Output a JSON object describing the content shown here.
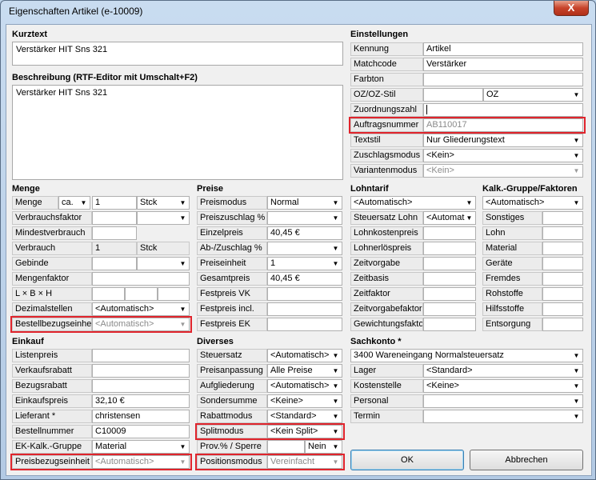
{
  "window": {
    "title": "Eigenschaften Artikel  (e-10009)",
    "close": "X"
  },
  "kurztext": {
    "heading": "Kurztext",
    "value": "Verstärker HIT Sns 321"
  },
  "beschreibung": {
    "heading": "Beschreibung (RTF-Editor mit Umschalt+F2)",
    "value": "Verstärker HIT Sns 321"
  },
  "einstellungen": {
    "heading": "Einstellungen",
    "kennung": {
      "label": "Kennung",
      "value": "Artikel"
    },
    "matchcode": {
      "label": "Matchcode",
      "value": "Verstärker"
    },
    "farbton": {
      "label": "Farbton",
      "value": ""
    },
    "ozstil": {
      "label": "OZ/OZ-Stil",
      "value1": "",
      "value2": "OZ"
    },
    "zuordnungszahl": {
      "label": "Zuordnungszahl",
      "value": ""
    },
    "auftragsnummer": {
      "label": "Auftragsnummer",
      "value": "AB110017"
    },
    "textstil": {
      "label": "Textstil",
      "value": "Nur Gliederungstext"
    },
    "zuschlagsmodus": {
      "label": "Zuschlagsmodus",
      "value": "<Kein>"
    },
    "variantenmodus": {
      "label": "Variantenmodus",
      "value": "<Kein>"
    }
  },
  "menge": {
    "heading": "Menge",
    "menge": {
      "label": "Menge",
      "prefix": "ca.",
      "value": "1",
      "unit": "Stck"
    },
    "verbrauchsfaktor": {
      "label": "Verbrauchsfaktor"
    },
    "mindestverbrauch": {
      "label": "Mindestverbrauch"
    },
    "verbrauch": {
      "label": "Verbrauch",
      "value": "1",
      "unit": "Stck"
    },
    "gebinde": {
      "label": "Gebinde"
    },
    "mengenfaktor": {
      "label": "Mengenfaktor"
    },
    "lbh": {
      "label": "L × B × H"
    },
    "dezimalstellen": {
      "label": "Dezimalstellen",
      "value": "<Automatisch>"
    },
    "bestellbezugseinheit": {
      "label": "Bestellbezugseinheit",
      "value": "<Automatisch>"
    }
  },
  "preise": {
    "heading": "Preise",
    "preismodus": {
      "label": "Preismodus",
      "value": "Normal"
    },
    "preiszuschlag": {
      "label": "Preiszuschlag %"
    },
    "einzelpreis": {
      "label": "Einzelpreis",
      "value": "40,45 €"
    },
    "abzuschlag": {
      "label": "Ab-/Zuschlag %"
    },
    "preiseinheit": {
      "label": "Preiseinheit",
      "value": "1"
    },
    "gesamtpreis": {
      "label": "Gesamtpreis",
      "value": "40,45 €"
    },
    "festpreisvk": {
      "label": "Festpreis VK"
    },
    "festpreisincl": {
      "label": "Festpreis incl."
    },
    "festpreisek": {
      "label": "Festpreis EK"
    }
  },
  "lohntarif": {
    "heading": "Lohntarif",
    "select": "<Automatisch>",
    "steuersatz": {
      "label": "Steuersatz Lohn",
      "value": "<Automat"
    },
    "rows": [
      "Lohnkostenpreis",
      "Lohnerlöspreis",
      "Zeitvorgabe",
      "Zeitbasis",
      "Zeitfaktor",
      "Zeitvorgabefaktor",
      "Gewichtungsfaktor"
    ]
  },
  "kalk": {
    "heading": "Kalk.-Gruppe/Faktoren",
    "select": "<Automatisch>",
    "rows": [
      "Sonstiges",
      "Lohn",
      "Material",
      "Geräte",
      "Fremdes",
      "Rohstoffe",
      "Hilfsstoffe",
      "Entsorgung"
    ]
  },
  "einkauf": {
    "heading": "Einkauf",
    "listenpreis": {
      "label": "Listenpreis"
    },
    "verkaufsrabatt": {
      "label": "Verkaufsrabatt"
    },
    "bezugsrabatt": {
      "label": "Bezugsrabatt"
    },
    "einkaufspreis": {
      "label": "Einkaufspreis",
      "value": "32,10 €"
    },
    "lieferant": {
      "label": "Lieferant *",
      "value": "christensen"
    },
    "bestellnummer": {
      "label": "Bestellnummer",
      "value": "C10009"
    },
    "ekkalk": {
      "label": "EK-Kalk.-Gruppe",
      "value": "Material"
    },
    "preisbezugseinheit": {
      "label": "Preisbezugseinheit",
      "value": "<Automatisch>"
    }
  },
  "diverses": {
    "heading": "Diverses",
    "steuersatz": {
      "label": "Steuersatz",
      "value": "<Automatisch>"
    },
    "preisanpassung": {
      "label": "Preisanpassung",
      "value": "Alle Preise"
    },
    "aufgliederung": {
      "label": "Aufgliederung",
      "value": "<Automatisch>"
    },
    "sondersumme": {
      "label": "Sondersumme",
      "value": "<Keine>"
    },
    "rabattmodus": {
      "label": "Rabattmodus",
      "value": "<Standard>"
    },
    "splitmodus": {
      "label": "Splitmodus",
      "value": "<Kein Split>"
    },
    "prov": {
      "label": "Prov.% / Sperre",
      "value": "Nein"
    },
    "positionsmodus": {
      "label": "Positionsmodus",
      "value": "Vereinfacht"
    }
  },
  "sachkonto": {
    "heading": "Sachkonto *",
    "value": "3400 Wareneingang Normalsteuersatz",
    "lager": {
      "label": "Lager",
      "value": "<Standard>"
    },
    "kostenstelle": {
      "label": "Kostenstelle",
      "value": "<Keine>"
    },
    "personal": {
      "label": "Personal",
      "value": ""
    },
    "termin": {
      "label": "Termin",
      "value": ""
    }
  },
  "buttons": {
    "ok": "OK",
    "cancel": "Abbrechen"
  },
  "icons": {
    "dropdown": "chevron-down-icon",
    "close": "close-icon"
  },
  "colors": {
    "highlight": "#e0242c",
    "titlebar": "#c9dcf0"
  }
}
